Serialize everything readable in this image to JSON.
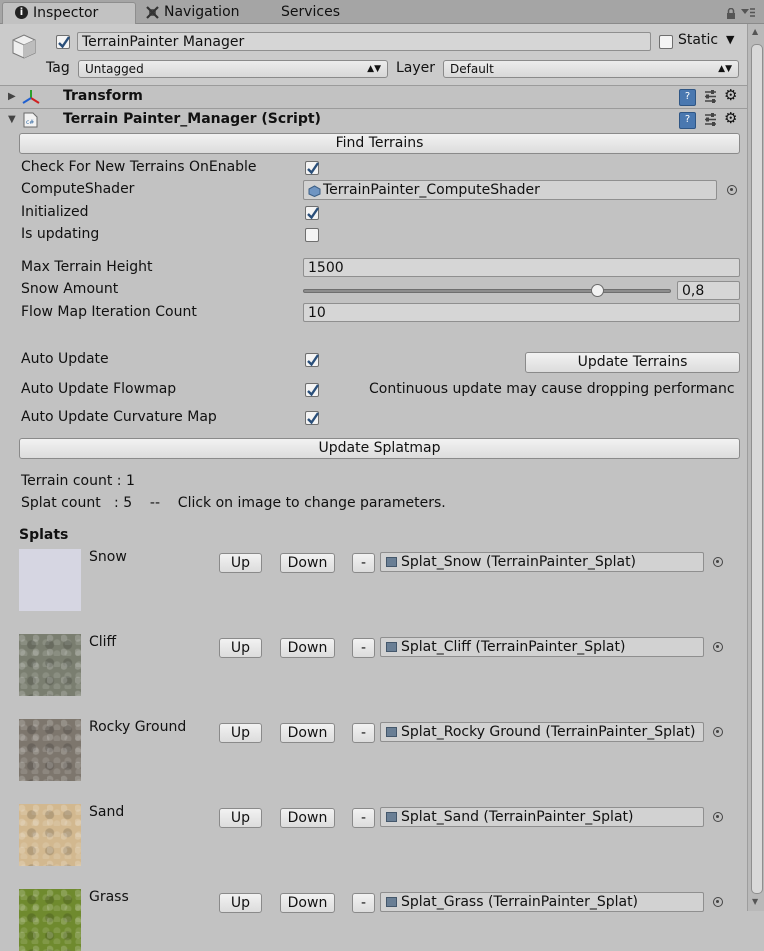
{
  "tabs": [
    {
      "label": "Inspector",
      "icon": "info-icon"
    },
    {
      "label": "Navigation",
      "icon": "navigation-icon"
    },
    {
      "label": "Services",
      "icon": ""
    }
  ],
  "header": {
    "object_name": "TerrainPainter Manager",
    "active": true,
    "static_label": "Static",
    "static_checked": false,
    "tag_label": "Tag",
    "tag_value": "Untagged",
    "layer_label": "Layer",
    "layer_value": "Default"
  },
  "components": {
    "transform_title": "Transform",
    "script_title": "Terrain Painter_Manager (Script)"
  },
  "script": {
    "find_terrains": "Find Terrains",
    "check_new_label": "Check For New Terrains OnEnable",
    "check_new_value": true,
    "compute_shader_label": "ComputeShader",
    "compute_shader_value": "TerrainPainter_ComputeShader",
    "initialized_label": "Initialized",
    "initialized_value": true,
    "is_updating_label": "Is updating",
    "is_updating_value": false,
    "max_height_label": "Max Terrain Height",
    "max_height_value": "1500",
    "snow_amount_label": "Snow Amount",
    "snow_amount_value": "0,8",
    "snow_amount_fraction": 0.8,
    "flow_iter_label": "Flow Map Iteration Count",
    "flow_iter_value": "10",
    "auto_update_label": "Auto Update",
    "auto_update_value": true,
    "update_terrains": "Update Terrains",
    "auto_flowmap_label": "Auto Update Flowmap",
    "auto_flowmap_value": true,
    "warning_text": "Continuous update may cause dropping performanc",
    "auto_curvature_label": "Auto Update Curvature Map",
    "auto_curvature_value": true,
    "update_splatmap": "Update Splatmap",
    "terrain_count": "Terrain count : 1",
    "splat_count": "Splat count   : 5    --    Click on image to change parameters.",
    "splats_heading": "Splats"
  },
  "splat_buttons": {
    "up": "Up",
    "down": "Down",
    "remove": "-"
  },
  "splats": [
    {
      "name": "Snow",
      "asset": "Splat_Snow (TerrainPainter_Splat)",
      "color": "#d6d6e2"
    },
    {
      "name": "Cliff",
      "asset": "Splat_Cliff (TerrainPainter_Splat)",
      "color": "#7a7e70"
    },
    {
      "name": "Rocky Ground",
      "asset": "Splat_Rocky Ground (TerrainPainter_Splat)",
      "color": "#7d766d"
    },
    {
      "name": "Sand",
      "asset": "Splat_Sand (TerrainPainter_Splat)",
      "color": "#d2b88f"
    },
    {
      "name": "Grass",
      "asset": "Splat_Grass (TerrainPainter_Splat)",
      "color": "#6f8a2e"
    }
  ],
  "colors": {
    "accent_check": "#3d6fa5",
    "panel_bg": "#c2c2c2"
  }
}
